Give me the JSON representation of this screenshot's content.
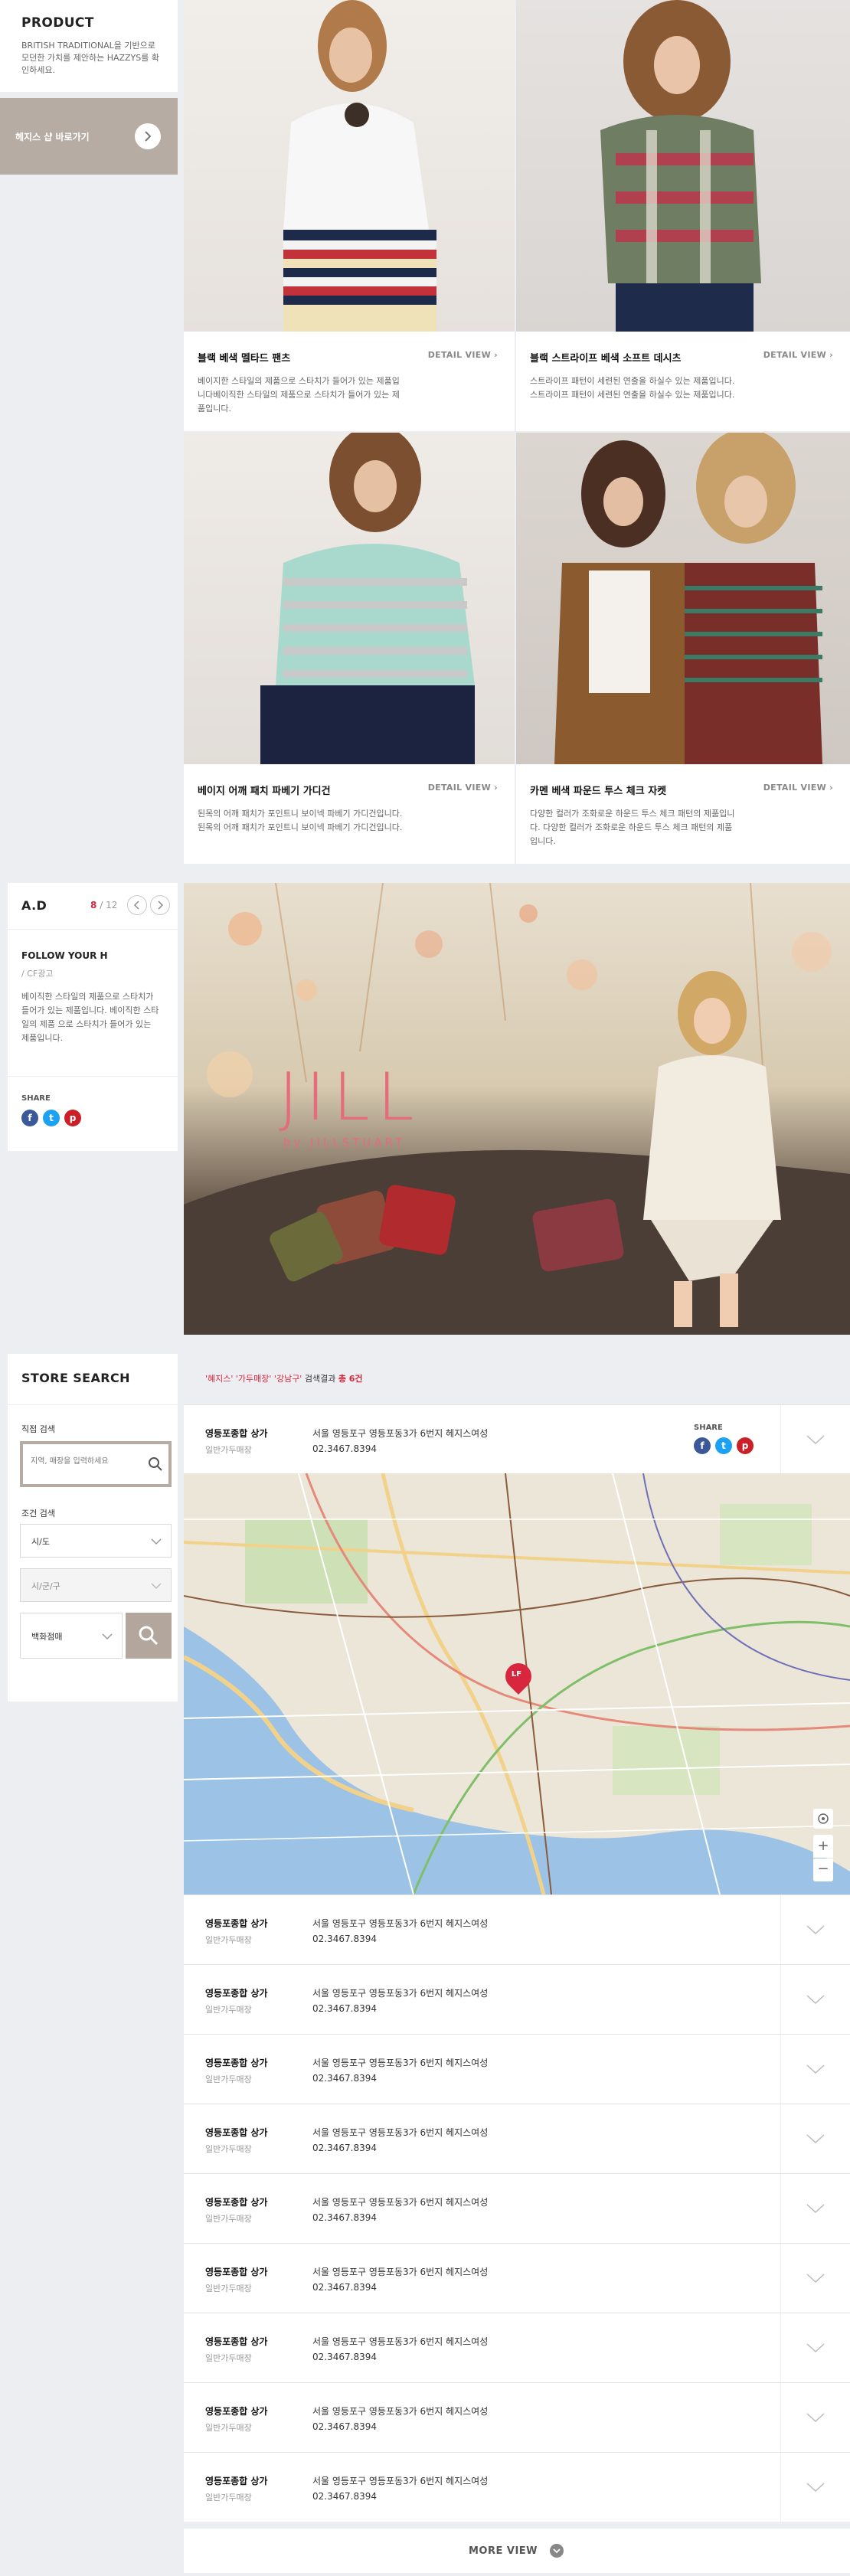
{
  "product": {
    "title": "PRODUCT",
    "intro": "BRITISH TRADITIONAL을 기반으로 모던한 가치를 제안하는 HAZZYS를 확인하세요.",
    "shop_button": "헤지스 샵 바로가기",
    "items": [
      {
        "title": "블랙 베색 멜타드 팬츠",
        "detail": "DETAIL VIEW",
        "desc": "베이지한 스타일의 제품으로 스타치가 들어가 있는 제품입니다베이직한 스타일의 제품으로 스타치가 들어가 있는 제품입니다."
      },
      {
        "title": "블랙 스트라이프 베색 소프트 데시츠",
        "detail": "DETAIL VIEW",
        "desc": "스트라이프 패턴이 세련된 연출을 하실수 있는 제품입니다. 스트라이프 패턴이 세련된 연출을 하실수 있는 제품입니다."
      },
      {
        "title": "베이지 어깨 패치 파베기 가디건",
        "detail": "DETAIL VIEW",
        "desc": "된목의 어깨 패치가 포인트니 보이넥 파베기 가디건입니다. 된목의 어깨 패치가 포인트니 보이넥 파베기 가디건입니다."
      },
      {
        "title": "카멘 베색 파운드 투스 체크 자켓",
        "detail": "DETAIL VIEW",
        "desc": "다양한 컬러가 조화로운 하운드 투스 체크 패턴의 제품입니다. 다양한 컬러가 조화로운 하운드 투스 체크 패턴의 제품입니다."
      }
    ]
  },
  "ad": {
    "title": "A.D",
    "page_current": "8",
    "page_sep": "/",
    "page_total": "12",
    "follow": "FOLLOW YOUR H",
    "sub": "/ CF광고",
    "desc": "베이직한 스타일의 제품으로 스타치가 들어가 있는 제품입니다. 베이직한 스타일의 제품 으로 스타치가 들어가 있는 제품입니다.",
    "share_label": "SHARE",
    "share_icons": [
      "facebook-icon",
      "twitter-icon",
      "pinterest-icon"
    ],
    "banner_brand": "JILL",
    "banner_sub": "by JILLSTUART"
  },
  "store_search": {
    "title": "STORE SEARCH",
    "direct_label": "직접 검색",
    "search_placeholder": "지역, 매장을 입력하세요",
    "cond_label": "조건 검색",
    "select_city": "시/도",
    "select_district": "시/군/구",
    "select_type": "백화점매",
    "result_prefix": "'혜지스' '가두매장' '강남구'",
    "result_mid": " 검색결과 ",
    "result_count": "총 6건",
    "share_label": "SHARE",
    "map_marker": "LF",
    "stores": [
      {
        "name": "영등포종합 상가",
        "type": "일반가두매장",
        "address": "서울 영등포구 영등포동3가 6번지 헤지스여성",
        "phone": "02.3467.8394"
      },
      {
        "name": "영등포종합 상가",
        "type": "일반가두매장",
        "address": "서울 영등포구 영등포동3가 6번지 헤지스여성",
        "phone": "02.3467.8394"
      },
      {
        "name": "영등포종합 상가",
        "type": "일반가두매장",
        "address": "서울 영등포구 영등포동3가 6번지 헤지스여성",
        "phone": "02.3467.8394"
      },
      {
        "name": "영등포종합 상가",
        "type": "일반가두매장",
        "address": "서울 영등포구 영등포동3가 6번지 헤지스여성",
        "phone": "02.3467.8394"
      },
      {
        "name": "영등포종합 상가",
        "type": "일반가두매장",
        "address": "서울 영등포구 영등포동3가 6번지 헤지스여성",
        "phone": "02.3467.8394"
      },
      {
        "name": "영등포종합 상가",
        "type": "일반가두매장",
        "address": "서울 영등포구 영등포동3가 6번지 헤지스여성",
        "phone": "02.3467.8394"
      },
      {
        "name": "영등포종합 상가",
        "type": "일반가두매장",
        "address": "서울 영등포구 영등포동3가 6번지 헤지스여성",
        "phone": "02.3467.8394"
      },
      {
        "name": "영등포종합 상가",
        "type": "일반가두매장",
        "address": "서울 영등포구 영등포동3가 6번지 헤지스여성",
        "phone": "02.3467.8394"
      },
      {
        "name": "영등포종합 상가",
        "type": "일반가두매장",
        "address": "서울 영등포구 영등포동3가 6번지 헤지스여성",
        "phone": "02.3467.8394"
      },
      {
        "name": "영등포종합 상가",
        "type": "일반가두매장",
        "address": "서울 영등포구 영등포동3가 6번지 헤지스여성",
        "phone": "02.3467.8394"
      }
    ],
    "more_view": "MORE VIEW"
  },
  "colors": {
    "accent_red": "#d7263d",
    "shop_button_bg": "#b7aca3",
    "search_button_bg": "#b3a69c",
    "facebook": "#3b5998",
    "twitter": "#1da1f2",
    "pinterest": "#cb2027"
  }
}
